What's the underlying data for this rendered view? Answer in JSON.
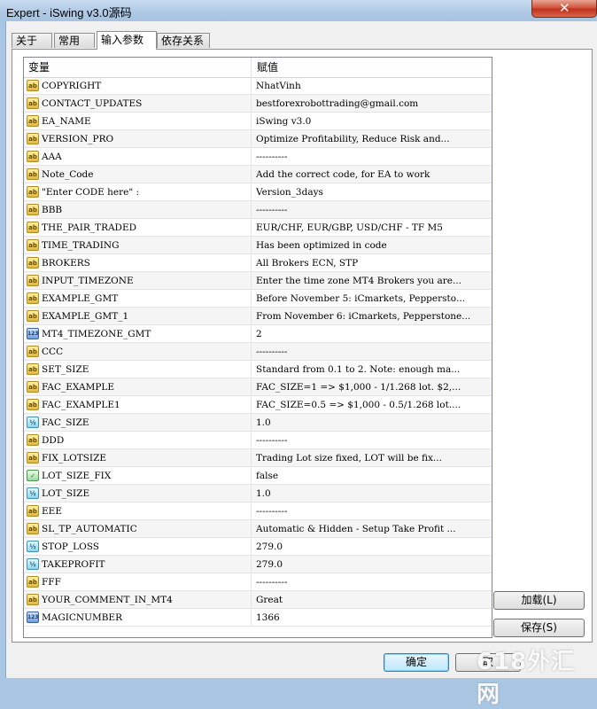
{
  "window": {
    "title": "Expert - iSwing v3.0源码",
    "close_glyph": "✕"
  },
  "tabs": [
    {
      "label": "关于",
      "active": false
    },
    {
      "label": "常用",
      "active": false
    },
    {
      "label": "输入参数",
      "active": true
    },
    {
      "label": "依存关系",
      "active": false
    }
  ],
  "grid": {
    "headers": {
      "variable": "变量",
      "value": "赋值"
    },
    "rows": [
      {
        "icon": "ab",
        "name": "COPYRIGHT",
        "value": "NhatVinh"
      },
      {
        "icon": "ab",
        "name": "CONTACT_UPDATES",
        "value": "bestforexrobottrading@gmail.com"
      },
      {
        "icon": "ab",
        "name": "EA_NAME",
        "value": "iSwing v3.0"
      },
      {
        "icon": "ab",
        "name": "VERSION_PRO",
        "value": "Optimize Profitability, Reduce Risk and..."
      },
      {
        "icon": "ab",
        "name": "AAA",
        "value": "----------"
      },
      {
        "icon": "ab",
        "name": "Note_Code",
        "value": "Add the correct code, for EA to work"
      },
      {
        "icon": "ab",
        "name": "\"Enter CODE here\"  :",
        "value": "Version_3days"
      },
      {
        "icon": "ab",
        "name": "BBB",
        "value": "----------"
      },
      {
        "icon": "ab",
        "name": "THE_PAIR_TRADED",
        "value": "EUR/CHF, EUR/GBP, USD/CHF - TF M5"
      },
      {
        "icon": "ab",
        "name": "TIME_TRADING",
        "value": "Has been optimized in code"
      },
      {
        "icon": "ab",
        "name": "BROKERS",
        "value": "All Brokers ECN, STP"
      },
      {
        "icon": "ab",
        "name": "INPUT_TIMEZONE",
        "value": "Enter the time zone MT4 Brokers you are..."
      },
      {
        "icon": "ab",
        "name": "EXAMPLE_GMT",
        "value": "Before November 5: iCmarkets, Pepperstо..."
      },
      {
        "icon": "ab",
        "name": "EXAMPLE_GMT_1",
        "value": "From November 6: iCmarkets, Pepperstone..."
      },
      {
        "icon": "123",
        "name": "MT4_TIMEZONE_GMT",
        "value": "2"
      },
      {
        "icon": "ab",
        "name": "CCC",
        "value": "----------"
      },
      {
        "icon": "ab",
        "name": "SET_SIZE",
        "value": "Standard from 0.1 to 2. Note: enough ma..."
      },
      {
        "icon": "ab",
        "name": "FAC_EXAMPLE",
        "value": "FAC_SIZE=1 => $1,000 - 1/1.268 lot. $2,..."
      },
      {
        "icon": "ab",
        "name": "FAC_EXAMPLE1",
        "value": "FAC_SIZE=0.5 => $1,000 - 0.5/1.268 lot...."
      },
      {
        "icon": "½",
        "name": "FAC_SIZE",
        "value": "1.0"
      },
      {
        "icon": "ab",
        "name": "DDD",
        "value": "----------"
      },
      {
        "icon": "ab",
        "name": "FIX_LOTSIZE",
        "value": "Trading Lot size fixed, LOT will be fix..."
      },
      {
        "icon": "✓",
        "name": "LOT_SIZE_FIX",
        "value": "false"
      },
      {
        "icon": "½",
        "name": "LOT_SIZE",
        "value": "1.0"
      },
      {
        "icon": "ab",
        "name": "EEE",
        "value": "----------"
      },
      {
        "icon": "ab",
        "name": "SL_TP_AUTOMATIC",
        "value": "Automatic & Hidden - Setup Take Profit ..."
      },
      {
        "icon": "½",
        "name": "STOP_LOSS",
        "value": "279.0"
      },
      {
        "icon": "½",
        "name": "TAKEPROFIT",
        "value": "279.0"
      },
      {
        "icon": "ab",
        "name": "FFF",
        "value": "----------"
      },
      {
        "icon": "ab",
        "name": "YOUR_COMMENT_IN_MT4",
        "value": "Great"
      },
      {
        "icon": "123",
        "name": "MAGICNUMBER",
        "value": "1366"
      }
    ]
  },
  "buttons": {
    "load": "加载(L)",
    "save": "保存(S)",
    "ok": "确定",
    "cancel": "取"
  },
  "watermark": "618外汇网"
}
